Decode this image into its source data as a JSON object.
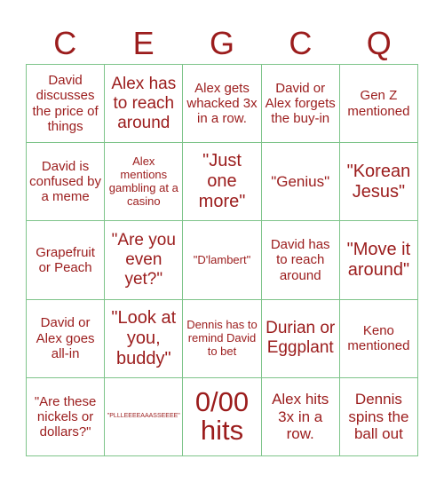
{
  "header": {
    "letters": [
      "C",
      "E",
      "G",
      "C",
      "Q"
    ]
  },
  "board": {
    "rows": [
      [
        {
          "text": "David discusses the price of things",
          "size": "m"
        },
        {
          "text": "Alex has to reach around",
          "size": "l"
        },
        {
          "text": "Alex gets whacked 3x in a row.",
          "size": "m"
        },
        {
          "text": "David or Alex forgets the buy-in",
          "size": "m"
        },
        {
          "text": "Gen Z mentioned",
          "size": "m"
        }
      ],
      [
        {
          "text": "David is confused by a meme",
          "size": "m"
        },
        {
          "text": "Alex mentions gambling at a casino",
          "size": "s"
        },
        {
          "text": "\"Just one more\"",
          "size": "xl"
        },
        {
          "text": "\"Genius\"",
          "size": "ml"
        },
        {
          "text": "\"Korean Jesus\"",
          "size": "xl"
        }
      ],
      [
        {
          "text": "Grapefruit or Peach",
          "size": "m"
        },
        {
          "text": "\"Are you even yet?\"",
          "size": "l"
        },
        {
          "text": "\"D'lambert\"",
          "size": "s"
        },
        {
          "text": "David has to reach around",
          "size": "m"
        },
        {
          "text": "\"Move it around\"",
          "size": "xl"
        }
      ],
      [
        {
          "text": "David or Alex goes all-in",
          "size": "m"
        },
        {
          "text": "\"Look at you, buddy\"",
          "size": "xl"
        },
        {
          "text": "Dennis has to remind David to bet",
          "size": "s"
        },
        {
          "text": "Durian or Eggplant",
          "size": "l"
        },
        {
          "text": "Keno mentioned",
          "size": "m"
        }
      ],
      [
        {
          "text": "\"Are these nickels or dollars?\"",
          "size": "m"
        },
        {
          "text": "\"PLLLEEEEAAASSEEEE\"",
          "size": "xs"
        },
        {
          "text": "0/00 hits",
          "size": "xxl"
        },
        {
          "text": "Alex hits 3x in a row.",
          "size": "ml"
        },
        {
          "text": "Dennis spins the ball out",
          "size": "ml"
        }
      ]
    ]
  },
  "colors": {
    "text": "#9b1c1c",
    "grid": "#7ec48a",
    "background": "#ffffff"
  }
}
